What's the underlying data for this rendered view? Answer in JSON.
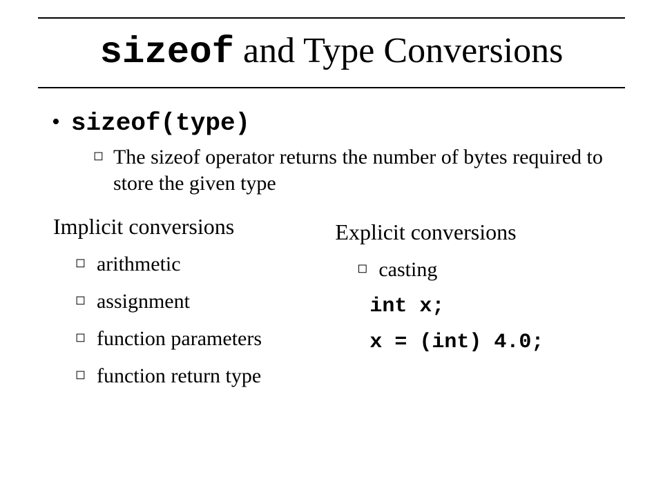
{
  "title": {
    "mono": "sizeof",
    "rest": " and Type Conversions"
  },
  "bullet1": {
    "code": "sizeof(type)",
    "desc": "The sizeof operator returns the number of bytes required to store the given type"
  },
  "left": {
    "heading": "Implicit conversions",
    "items": [
      "arithmetic",
      "assignment",
      "function parameters",
      "function return type"
    ]
  },
  "right": {
    "heading": "Explicit conversions",
    "item": "casting",
    "code1": "int x;",
    "code2": "x = (int) 4.0;"
  },
  "glyph": {
    "dot": "•",
    "square": "◻"
  }
}
